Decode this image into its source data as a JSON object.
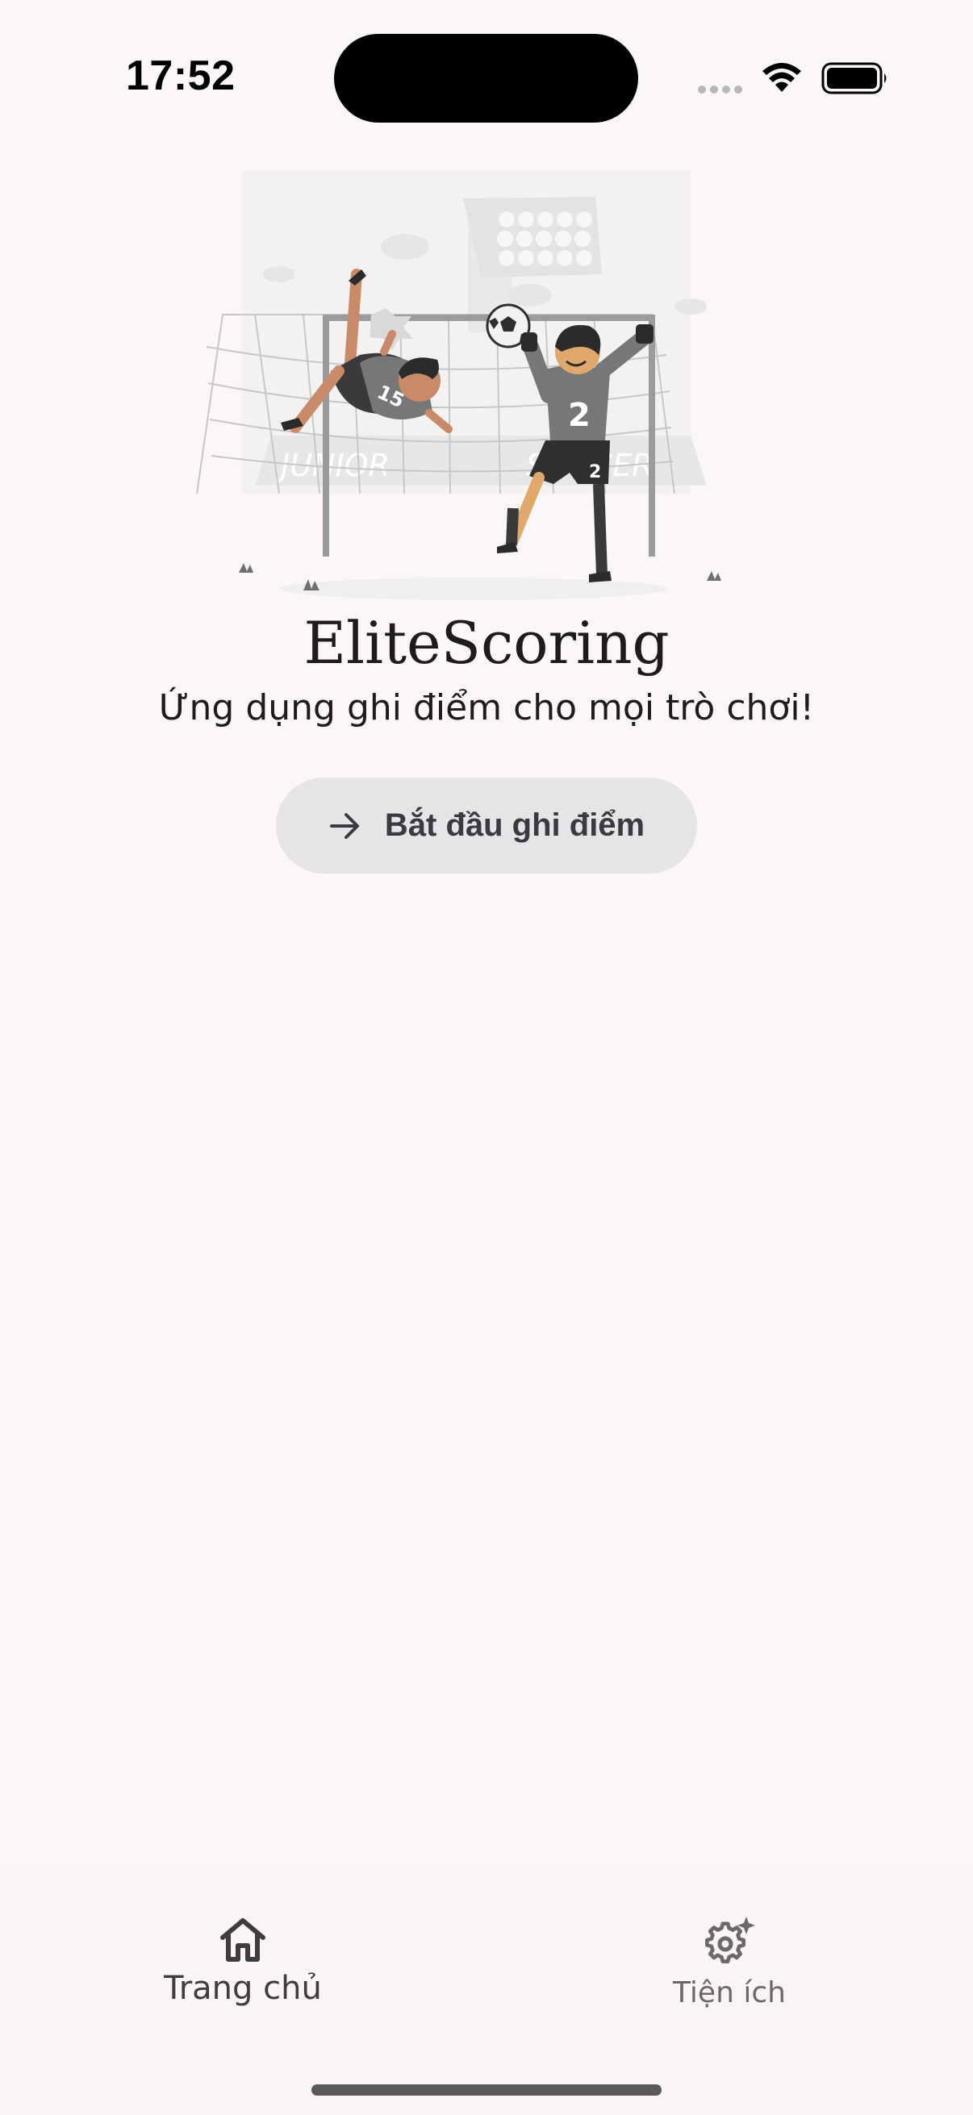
{
  "status_bar": {
    "time": "17:52"
  },
  "home": {
    "title": "EliteScoring",
    "tagline": "Ứng dụng ghi điểm cho mọi trò chơi!",
    "start_button_label": "Bắt đầu ghi điểm",
    "illustration_text": {
      "banner_left": "JUNIOR",
      "banner_right": "SOCCER",
      "jersey_kicker": "15",
      "jersey_keeper": "2",
      "shorts_keeper": "2"
    }
  },
  "bottom_nav": {
    "items": [
      {
        "label": "Trang chủ",
        "icon": "home-icon",
        "active": true
      },
      {
        "label": "Tiện ích",
        "icon": "settings-sparkle-icon",
        "active": false
      }
    ]
  },
  "colors": {
    "background": "#faf7f6",
    "button_bg": "#e6e4e6",
    "text_primary": "#1d1b1f",
    "nav_inactive": "#6a686c"
  }
}
